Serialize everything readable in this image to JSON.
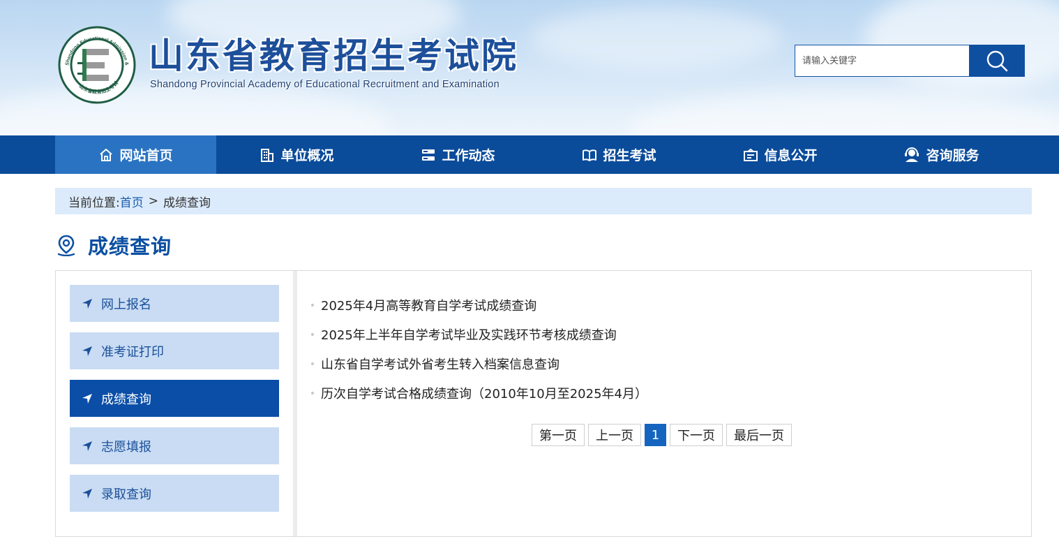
{
  "header": {
    "title": "山东省教育招生考试院",
    "subtitle": "Shandong Provincial Academy of Educational Recruitment and Examination",
    "seal_text": "Shandong Educational Admission & Examination 山东省教育招生考试院"
  },
  "search": {
    "placeholder": "请输入关键字",
    "button_icon": "search-icon"
  },
  "nav": {
    "items": [
      {
        "label": "网站首页",
        "icon": "home-icon",
        "active": true
      },
      {
        "label": "单位概况",
        "icon": "building-icon",
        "active": false
      },
      {
        "label": "工作动态",
        "icon": "server-list-icon",
        "active": false
      },
      {
        "label": "招生考试",
        "icon": "open-book-icon",
        "active": false
      },
      {
        "label": "信息公开",
        "icon": "info-board-icon",
        "active": false
      },
      {
        "label": "咨询服务",
        "icon": "support-agent-icon",
        "active": false
      }
    ]
  },
  "breadcrumb": {
    "prefix": "当前位置:",
    "home": "首页",
    "separator": ">",
    "current": "成绩查询"
  },
  "page_title": "成绩查询",
  "sidebar": {
    "items": [
      {
        "label": "网上报名",
        "active": false
      },
      {
        "label": "准考证打印",
        "active": false
      },
      {
        "label": "成绩查询",
        "active": true
      },
      {
        "label": "志愿填报",
        "active": false
      },
      {
        "label": "录取查询",
        "active": false
      }
    ]
  },
  "articles": [
    "2025年4月高等教育自学考试成绩查询",
    "2025年上半年自学考试毕业及实践环节考核成绩查询",
    "山东省自学考试外省考生转入档案信息查询",
    "历次自学考试合格成绩查询（2010年10月至2025年4月）"
  ],
  "pager": {
    "first": "第一页",
    "prev": "上一页",
    "current": "1",
    "next": "下一页",
    "last": "最后一页"
  },
  "colors": {
    "primary": "#0a4b9a",
    "nav_active": "#2a73c2",
    "sidebar_bg": "#c9dcf3",
    "sidebar_active": "#0b4ea7",
    "breadcrumb_bg": "#dcebfb"
  }
}
